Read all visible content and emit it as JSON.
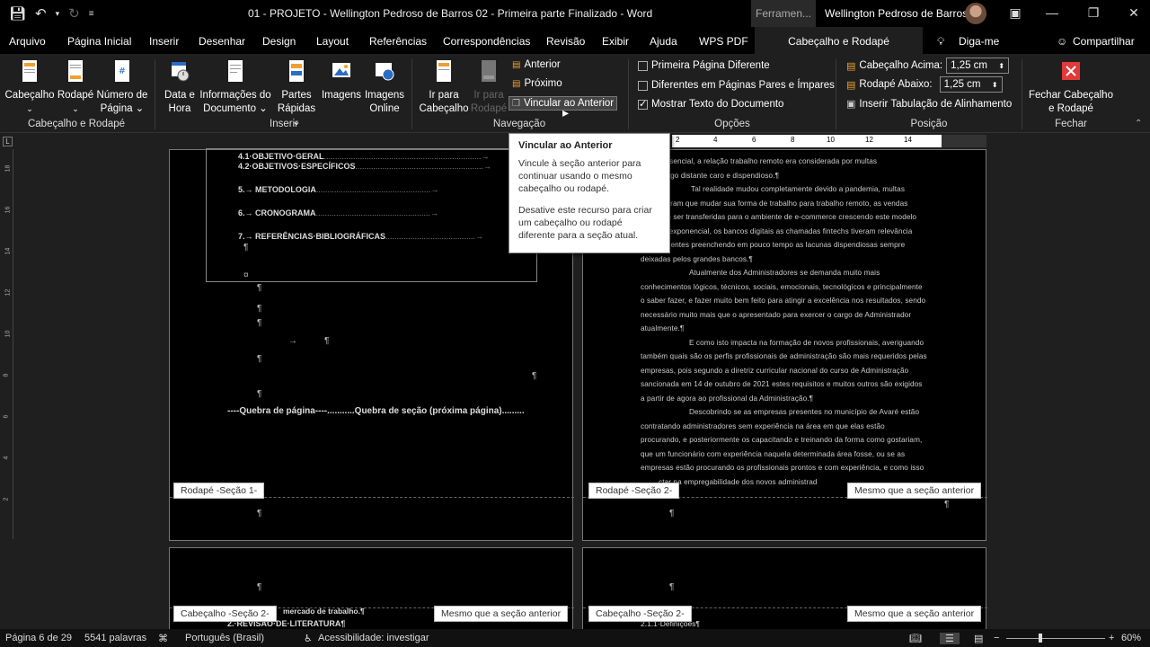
{
  "window": {
    "title": "01 - PROJETO - Wellington Pedroso de Barros 02 - Primeira parte Finalizado  -  Word",
    "tool_tab": "Ferramen...",
    "user": "Wellington Pedroso de Barros"
  },
  "tabs": [
    "Arquivo",
    "Página Inicial",
    "Inserir",
    "Desenhar",
    "Design",
    "Layout",
    "Referências",
    "Correspondências",
    "Revisão",
    "Exibir",
    "Ajuda",
    "WPS PDF",
    "Cabeçalho e Rodapé",
    "Diga-me",
    "Compartilhar"
  ],
  "ribbon": {
    "cab_group": {
      "cabecalho": "Cabeçalho",
      "rodape": "Rodapé",
      "numero": "Número de",
      "pagina": "Página",
      "label": "Cabeçalho e Rodapé"
    },
    "inserir_group": {
      "data": "Data e",
      "hora": "Hora",
      "info1": "Informações do",
      "info2": "Documento",
      "partes1": "Partes",
      "partes2": "Rápidas",
      "imagens": "Imagens",
      "imagens_online1": "Imagens",
      "imagens_online2": "Online",
      "label": "Inserir"
    },
    "nav_group": {
      "ir_cab1": "Ir para",
      "ir_cab2": "Cabeçalho",
      "ir_rod1": "Ir para",
      "ir_rod2": "Rodapé",
      "anterior": "Anterior",
      "proximo": "Próximo",
      "vincular": "Vincular ao Anterior",
      "label": "Navegação"
    },
    "opcoes_group": {
      "primeira": "Primeira Página Diferente",
      "pares": "Diferentes em Páginas Pares e Ímpares",
      "mostrar": "Mostrar Texto do Documento",
      "label": "Opções"
    },
    "posicao_group": {
      "cab_acima": "Cabeçalho Acima:",
      "cab_val": "1,25 cm",
      "rod_abaixo": "Rodapé Abaixo:",
      "rod_val": "1,25 cm",
      "tab_alinh": "Inserir Tabulação de Alinhamento",
      "label": "Posição"
    },
    "fechar_group": {
      "fechar1": "Fechar Cabeçalho",
      "fechar2": "e Rodapé",
      "label": "Fechar"
    }
  },
  "tooltip": {
    "title": "Vincular ao Anterior",
    "p1": "Vincule à seção anterior para continuar usando o mesmo cabeçalho ou rodapé.",
    "p2": "Desative este recurso para criar um cabeçalho ou rodapé diferente para a seção atual."
  },
  "ruler": {
    "top_ticks": [
      "2",
      "4",
      "6",
      "8",
      "10",
      "12",
      "14"
    ],
    "left_ticks": [
      "18",
      "16",
      "14",
      "12",
      "10",
      "8",
      "6",
      "4",
      "2"
    ]
  },
  "page_left": {
    "toc": [
      {
        "label": "4.1·OBJETIVO·GERAL",
        "dots": "......................................................................→"
      },
      {
        "label": "4.2·OBJETIVOS·ESPECÍFICOS",
        "dots": ".........................................................→"
      },
      {
        "label": "5.→ METODOLOGIA",
        "dots": "...................................................→"
      },
      {
        "label": "6.→ CRONOGRAMA",
        "dots": "...................................................→"
      },
      {
        "label": "7.→ REFERÊNCIAS·BIBLIOGRÁFICAS",
        "dots": "........................................→"
      }
    ],
    "section_break": "----Quebra de página----...........Quebra de seção (próxima página).........",
    "footer_tag": "Rodapé -Seção 1-"
  },
  "page_right": {
    "lines": [
      "presencial, a relação trabalho remoto era considerada por multas",
      "s algo distante caro e dispendioso.¶",
      "Tal realidade mudou completamente devido a pandemia, multas",
      "tiveram que mudar sua forma de trabalho para trabalho remoto, as vendas",
      "que ser transferidas para o ambiente de e-commerce crescendo este modelo",
      "ira exponencial, os bancos digitais as chamadas fintechs tiveram relevância",
      "cedentes preenchendo em pouco tempo as lacunas dispendiosas sempre",
      "deixadas pelos grandes bancos.¶",
      "Atualmente dos Administradores se demanda muito mais",
      "conhecimentos lógicos, técnicos, sociais, emocionais, tecnológicos e principalmente",
      "o saber fazer, e fazer muito bem feito para atingir a excelência nos resultados, sendo",
      "necessário muito mais que o apresentado para exercer o cargo de Administrador",
      "atualmente.¶",
      "E como isto impacta na formação de novos profissionais, averiguando",
      "também quais são os perfis profissionais de administração são mais requeridos pelas",
      "empresas, pois segundo a diretriz curricular nacional do curso de Administração",
      "sancionada em 14 de outubro de 2021 estes requisitos e muitos outros são exigidos",
      "a partir de agora ao profissional da Administração.¶",
      "Descobrindo se as empresas presentes no município de Avaré estão",
      "contratando administradores sem experiência na área em que elas estão",
      "procurando, e posteriormente os capacitando e treinando da forma como gostariam,",
      "que um funcionário com experiência naquela determinada área fosse, ou se as",
      "empresas estão procurando os profissionais prontos e com experiência, e como isso",
      "ctar na empregabilidade dos novos administrad"
    ],
    "footer_tag": "Rodapé -Seção 2-",
    "same_tag": "Mesmo que a seção anterior"
  },
  "page_bottom_left": {
    "header_tag": "Cabeçalho -Seção 2-",
    "same_tag": "Mesmo que a seção anterior",
    "line1": "mercado de trabalho.¶",
    "line2": "2.·REVISÃO·DE·LITERATURA¶"
  },
  "page_bottom_right": {
    "header_tag": "Cabeçalho -Seção 2-",
    "same_tag": "Mesmo que a seção anterior",
    "line1": "2.1.1·Definições¶"
  },
  "status": {
    "page": "Página 6 de 29",
    "words": "5541 palavras",
    "lang": "Português (Brasil)",
    "access": "Acessibilidade: investigar",
    "zoom": "60%"
  },
  "pilcrow": "¶"
}
